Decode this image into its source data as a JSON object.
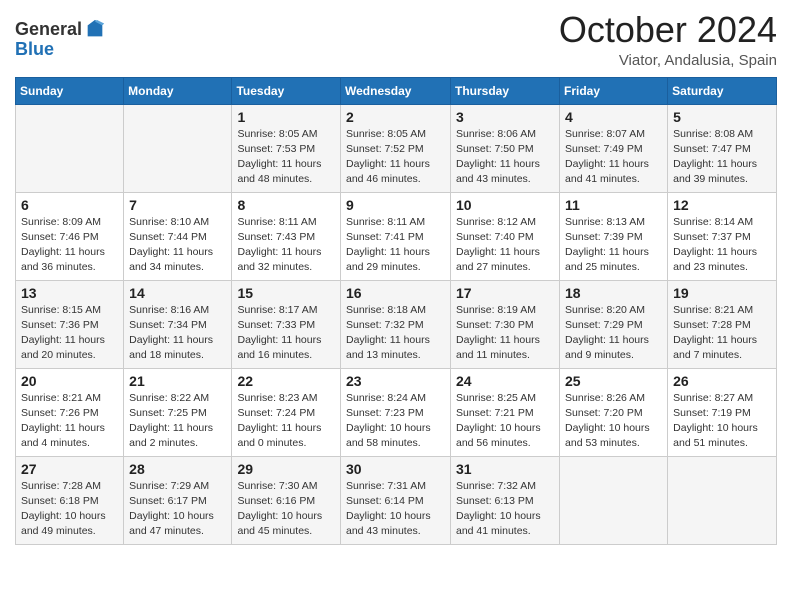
{
  "header": {
    "logo_general": "General",
    "logo_blue": "Blue",
    "month_title": "October 2024",
    "location": "Viator, Andalusia, Spain"
  },
  "days_of_week": [
    "Sunday",
    "Monday",
    "Tuesday",
    "Wednesday",
    "Thursday",
    "Friday",
    "Saturday"
  ],
  "weeks": [
    [
      {
        "day": "",
        "info": ""
      },
      {
        "day": "",
        "info": ""
      },
      {
        "day": "1",
        "info": "Sunrise: 8:05 AM\nSunset: 7:53 PM\nDaylight: 11 hours and 48 minutes."
      },
      {
        "day": "2",
        "info": "Sunrise: 8:05 AM\nSunset: 7:52 PM\nDaylight: 11 hours and 46 minutes."
      },
      {
        "day": "3",
        "info": "Sunrise: 8:06 AM\nSunset: 7:50 PM\nDaylight: 11 hours and 43 minutes."
      },
      {
        "day": "4",
        "info": "Sunrise: 8:07 AM\nSunset: 7:49 PM\nDaylight: 11 hours and 41 minutes."
      },
      {
        "day": "5",
        "info": "Sunrise: 8:08 AM\nSunset: 7:47 PM\nDaylight: 11 hours and 39 minutes."
      }
    ],
    [
      {
        "day": "6",
        "info": "Sunrise: 8:09 AM\nSunset: 7:46 PM\nDaylight: 11 hours and 36 minutes."
      },
      {
        "day": "7",
        "info": "Sunrise: 8:10 AM\nSunset: 7:44 PM\nDaylight: 11 hours and 34 minutes."
      },
      {
        "day": "8",
        "info": "Sunrise: 8:11 AM\nSunset: 7:43 PM\nDaylight: 11 hours and 32 minutes."
      },
      {
        "day": "9",
        "info": "Sunrise: 8:11 AM\nSunset: 7:41 PM\nDaylight: 11 hours and 29 minutes."
      },
      {
        "day": "10",
        "info": "Sunrise: 8:12 AM\nSunset: 7:40 PM\nDaylight: 11 hours and 27 minutes."
      },
      {
        "day": "11",
        "info": "Sunrise: 8:13 AM\nSunset: 7:39 PM\nDaylight: 11 hours and 25 minutes."
      },
      {
        "day": "12",
        "info": "Sunrise: 8:14 AM\nSunset: 7:37 PM\nDaylight: 11 hours and 23 minutes."
      }
    ],
    [
      {
        "day": "13",
        "info": "Sunrise: 8:15 AM\nSunset: 7:36 PM\nDaylight: 11 hours and 20 minutes."
      },
      {
        "day": "14",
        "info": "Sunrise: 8:16 AM\nSunset: 7:34 PM\nDaylight: 11 hours and 18 minutes."
      },
      {
        "day": "15",
        "info": "Sunrise: 8:17 AM\nSunset: 7:33 PM\nDaylight: 11 hours and 16 minutes."
      },
      {
        "day": "16",
        "info": "Sunrise: 8:18 AM\nSunset: 7:32 PM\nDaylight: 11 hours and 13 minutes."
      },
      {
        "day": "17",
        "info": "Sunrise: 8:19 AM\nSunset: 7:30 PM\nDaylight: 11 hours and 11 minutes."
      },
      {
        "day": "18",
        "info": "Sunrise: 8:20 AM\nSunset: 7:29 PM\nDaylight: 11 hours and 9 minutes."
      },
      {
        "day": "19",
        "info": "Sunrise: 8:21 AM\nSunset: 7:28 PM\nDaylight: 11 hours and 7 minutes."
      }
    ],
    [
      {
        "day": "20",
        "info": "Sunrise: 8:21 AM\nSunset: 7:26 PM\nDaylight: 11 hours and 4 minutes."
      },
      {
        "day": "21",
        "info": "Sunrise: 8:22 AM\nSunset: 7:25 PM\nDaylight: 11 hours and 2 minutes."
      },
      {
        "day": "22",
        "info": "Sunrise: 8:23 AM\nSunset: 7:24 PM\nDaylight: 11 hours and 0 minutes."
      },
      {
        "day": "23",
        "info": "Sunrise: 8:24 AM\nSunset: 7:23 PM\nDaylight: 10 hours and 58 minutes."
      },
      {
        "day": "24",
        "info": "Sunrise: 8:25 AM\nSunset: 7:21 PM\nDaylight: 10 hours and 56 minutes."
      },
      {
        "day": "25",
        "info": "Sunrise: 8:26 AM\nSunset: 7:20 PM\nDaylight: 10 hours and 53 minutes."
      },
      {
        "day": "26",
        "info": "Sunrise: 8:27 AM\nSunset: 7:19 PM\nDaylight: 10 hours and 51 minutes."
      }
    ],
    [
      {
        "day": "27",
        "info": "Sunrise: 7:28 AM\nSunset: 6:18 PM\nDaylight: 10 hours and 49 minutes."
      },
      {
        "day": "28",
        "info": "Sunrise: 7:29 AM\nSunset: 6:17 PM\nDaylight: 10 hours and 47 minutes."
      },
      {
        "day": "29",
        "info": "Sunrise: 7:30 AM\nSunset: 6:16 PM\nDaylight: 10 hours and 45 minutes."
      },
      {
        "day": "30",
        "info": "Sunrise: 7:31 AM\nSunset: 6:14 PM\nDaylight: 10 hours and 43 minutes."
      },
      {
        "day": "31",
        "info": "Sunrise: 7:32 AM\nSunset: 6:13 PM\nDaylight: 10 hours and 41 minutes."
      },
      {
        "day": "",
        "info": ""
      },
      {
        "day": "",
        "info": ""
      }
    ]
  ]
}
